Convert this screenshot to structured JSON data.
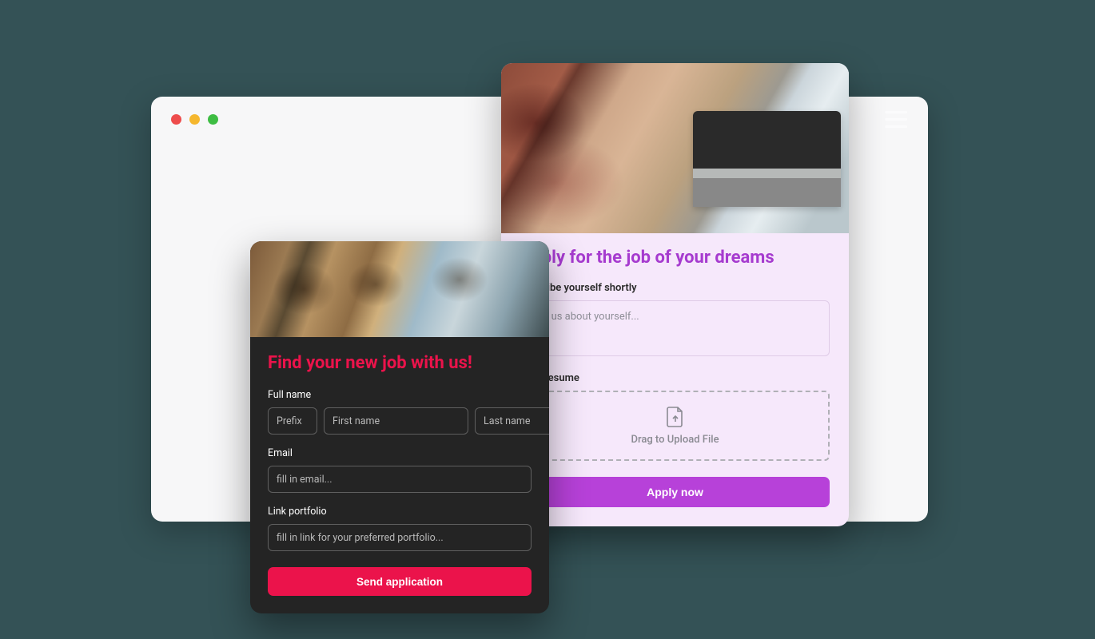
{
  "colors": {
    "page_bg": "#345256",
    "browser_bg": "#f7f7f8",
    "purple_accent": "#a63bcf",
    "purple_button": "#b741d9",
    "purple_card_bg": "#f6e8fb",
    "pink_accent": "#eb134b",
    "dark_card_bg": "#242424"
  },
  "window": {
    "controls": [
      "close",
      "minimize",
      "maximize"
    ]
  },
  "card_purple": {
    "title": "Apply for the job of your dreams",
    "describe_label": "Describe yourself shortly",
    "describe_placeholder": "Tell us about yourself...",
    "resume_label": "Your resume",
    "upload_text": "Drag to Upload File",
    "apply_button": "Apply now"
  },
  "card_dark": {
    "title": "Find your new job with us!",
    "fullname_label": "Full name",
    "prefix_placeholder": "Prefix",
    "firstname_placeholder": "First name",
    "lastname_placeholder": "Last name",
    "email_label": "Email",
    "email_placeholder": "fill in email...",
    "portfolio_label": "Link portfolio",
    "portfolio_placeholder": "fill in link for your preferred portfolio...",
    "send_button": "Send application"
  }
}
